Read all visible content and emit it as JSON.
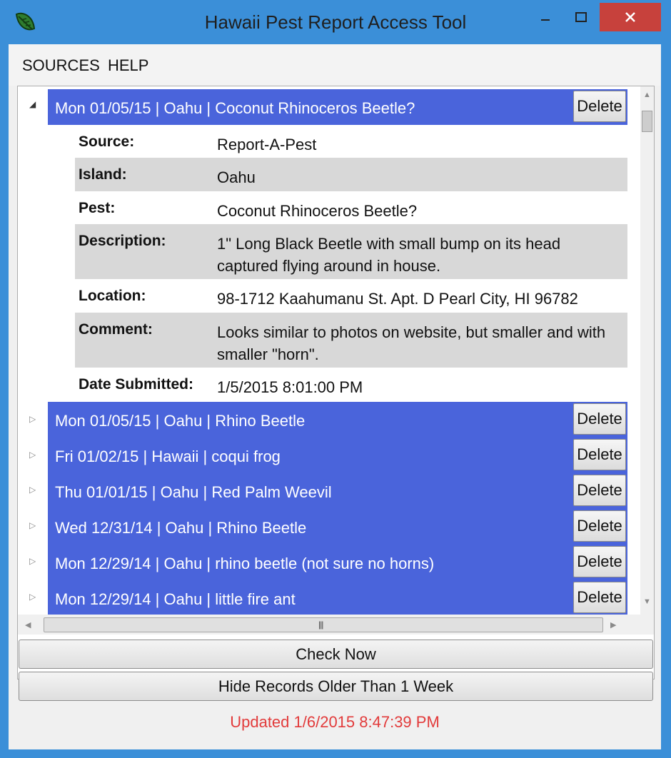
{
  "window": {
    "title": "Hawaii Pest Report Access Tool",
    "icon": "leaf-icon",
    "controls": {
      "minimize": "minimize-icon",
      "maximize": "maximize-icon",
      "close": "close-icon"
    }
  },
  "menu": [
    "SOURCES",
    "HELP"
  ],
  "records": [
    {
      "header": "Mon 01/05/15 | Oahu | Coconut Rhinoceros Beetle?",
      "expanded": true,
      "delete_label": "Delete",
      "details": [
        {
          "label": "Source:",
          "value": "Report-A-Pest"
        },
        {
          "label": "Island:",
          "value": "Oahu"
        },
        {
          "label": "Pest:",
          "value": "Coconut Rhinoceros Beetle?"
        },
        {
          "label": "Description:",
          "value": "1\" Long Black Beetle with small bump on its head captured flying around in house."
        },
        {
          "label": "Location:",
          "value": "98-1712 Kaahumanu St. Apt. D Pearl City, HI 96782"
        },
        {
          "label": "Comment:",
          "value": "Looks similar to photos on website, but smaller and with smaller \"horn\"."
        },
        {
          "label": "Date Submitted:",
          "value": "1/5/2015 8:01:00 PM"
        }
      ]
    },
    {
      "header": "Mon 01/05/15 | Oahu | Rhino Beetle",
      "expanded": false,
      "delete_label": "Delete"
    },
    {
      "header": "Fri 01/02/15 | Hawaii | coqui frog",
      "expanded": false,
      "delete_label": "Delete"
    },
    {
      "header": "Thu 01/01/15 | Oahu | Red Palm Weevil",
      "expanded": false,
      "delete_label": "Delete"
    },
    {
      "header": "Wed 12/31/14 | Oahu | Rhino Beetle",
      "expanded": false,
      "delete_label": "Delete"
    },
    {
      "header": "Mon 12/29/14 | Oahu | rhino beetle (not sure no horns)",
      "expanded": false,
      "delete_label": "Delete"
    },
    {
      "header": "Mon 12/29/14 | Oahu | little fire ant",
      "expanded": false,
      "delete_label": "Delete"
    }
  ],
  "buttons": {
    "check_now": "Check Now",
    "hide_old": "Hide Records Older Than 1 Week"
  },
  "status": "Updated 1/6/2015 8:47:39 PM",
  "colors": {
    "titlebar": "#3b8fd8",
    "row_header": "#4a64db",
    "close": "#c7413c",
    "status": "#e23b3b"
  }
}
